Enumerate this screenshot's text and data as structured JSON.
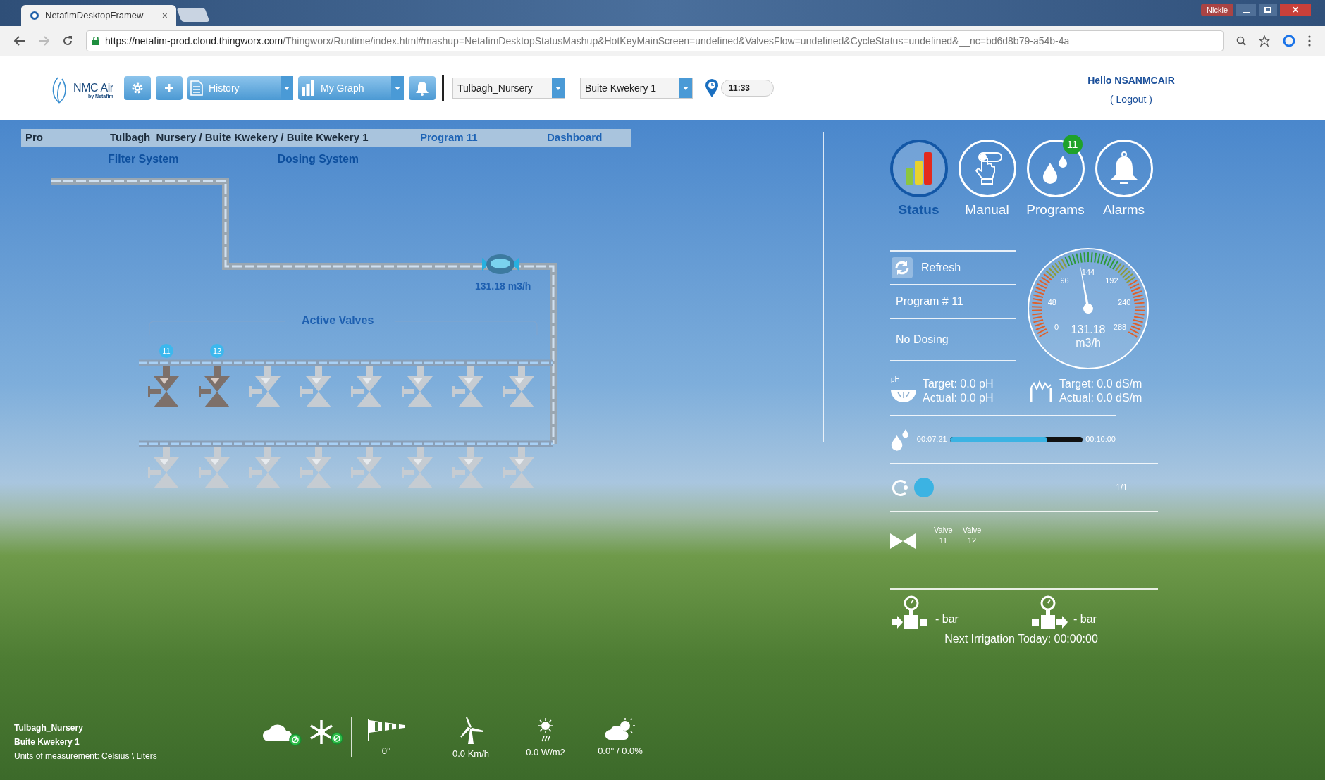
{
  "browser": {
    "tab_title": "NetafimDesktopFramew",
    "tab_close": "×",
    "user": "Nickie",
    "close_window": "✕",
    "url_host": "https://netafim-prod.cloud.thingworx.com",
    "url_path": "/Thingworx/Runtime/index.html#mashup=NetafimDesktopStatusMashup&HotKeyMainScreen=undefined&ValvesFlow=undefined&CycleStatus=undefined&__nc=bd6d8b79-a54b-4a"
  },
  "header": {
    "logo_text": "NMC Air",
    "logo_sub": "by Netafim",
    "history": "History",
    "graph": "My Graph",
    "site": "Tulbagh_Nursery",
    "block": "Buite Kwekery 1",
    "time": "11:33",
    "greeting": "Hello NSANMCAIR",
    "logout": "( Logout )"
  },
  "breadcrumb": {
    "mode": "Pro",
    "path": "Tulbagh_Nursery / Buite Kwekery / Buite Kwekery 1",
    "program": "Program 11",
    "dashboard": "Dashboard"
  },
  "systems": [
    "Filter System",
    "Dosing System"
  ],
  "diagram": {
    "flow": "131.18 m3/h",
    "active_label": "Active Valves",
    "rows": [
      [
        {
          "label": "11",
          "active": true
        },
        {
          "label": "12",
          "active": true
        },
        {
          "active": false
        },
        {
          "active": false
        },
        {
          "active": false
        },
        {
          "active": false
        },
        {
          "active": false
        },
        {
          "active": false
        }
      ],
      [
        {
          "active": false
        },
        {
          "active": false
        },
        {
          "active": false
        },
        {
          "active": false
        },
        {
          "active": false
        },
        {
          "active": false
        },
        {
          "active": false
        },
        {
          "active": false
        }
      ]
    ]
  },
  "nav": [
    {
      "kind": "status",
      "label": "Status",
      "selected": true
    },
    {
      "kind": "manual",
      "label": "Manual",
      "selected": false
    },
    {
      "kind": "programs",
      "label": "Programs",
      "selected": false,
      "badge": "11"
    },
    {
      "kind": "alarms",
      "label": "Alarms",
      "selected": false
    }
  ],
  "status": {
    "refresh": "Refresh",
    "program": "Program # 11",
    "dosing": "No Dosing"
  },
  "gauge": {
    "ticks": [
      "0",
      "48",
      "96",
      "144",
      "192",
      "240",
      "288"
    ],
    "level": 0.456,
    "value": "131.18",
    "unit": "m3/h"
  },
  "dosing_targets": [
    {
      "kind": "ph",
      "icon_label": "pH",
      "target": "Target: 0.0 pH",
      "actual": "Actual: 0.0 pH"
    },
    {
      "kind": "ec",
      "target": "Target: 0.0 dS/m",
      "actual": "Actual: 0.0 dS/m"
    }
  ],
  "progress": {
    "elapsed": "00:07:21",
    "total": "00:10:00",
    "level": 0.735
  },
  "cycle": {
    "count": "1/1"
  },
  "open_valves": [
    {
      "label": "Valve",
      "number": "11"
    },
    {
      "label": "Valve",
      "number": "12"
    }
  ],
  "pressure": [
    {
      "kind": "inlet",
      "reading": "- bar"
    },
    {
      "kind": "outlet",
      "reading": "- bar"
    }
  ],
  "next_irrigation": "Next Irrigation Today: 00:00:00",
  "footer": {
    "site": "Tulbagh_Nursery",
    "block": "Buite Kwekery 1",
    "units": "Units of measurement: Celsius \\ Liters",
    "weather": [
      {
        "kind": "wind_direction",
        "reading": "0°"
      },
      {
        "kind": "wind_speed",
        "reading": "0.0 Km/h"
      },
      {
        "kind": "radiation",
        "reading": "0.0 W/m2"
      },
      {
        "kind": "temperature_humidity",
        "reading": "0.0° / 0.0%"
      }
    ]
  }
}
